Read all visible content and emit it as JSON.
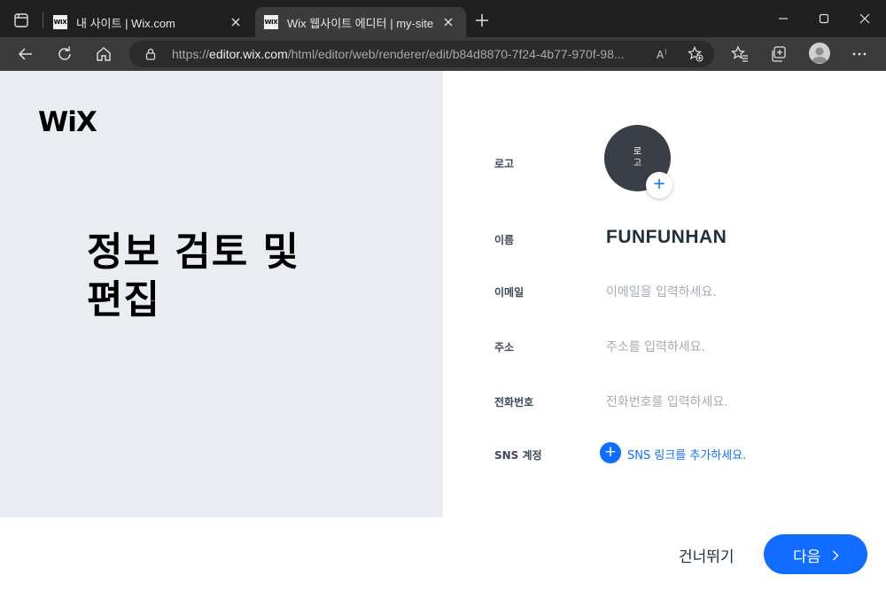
{
  "browser": {
    "tabs": [
      {
        "favicon": "WIX",
        "title": "내 사이트 | Wix.com",
        "active": false
      },
      {
        "favicon": "WIX",
        "title": "Wix 웹사이트 에디터 | my-site",
        "active": true
      }
    ],
    "url_scheme": "https://",
    "url_host": "editor.wix.com",
    "url_path": "/html/editor/web/renderer/edit/b84d8870-7f24-4b77-970f-98..."
  },
  "page": {
    "brand": "WiX",
    "title_line1": "정보 검토 및",
    "title_line2": "편집",
    "fields": {
      "logo": {
        "label": "로고",
        "placeholder_line1": "로",
        "placeholder_line2": "고",
        "add_icon": "+"
      },
      "name": {
        "label": "이름",
        "value": "FUNFUNHAN"
      },
      "email": {
        "label": "이메일",
        "placeholder": "이메일을 입력하세요."
      },
      "address": {
        "label": "주소",
        "placeholder": "주소를 입력하세요."
      },
      "phone": {
        "label": "전화번호",
        "placeholder": "전화번호를 입력하세요."
      },
      "sns": {
        "label": "SNS 계정",
        "link": "SNS 링크를 추가하세요.",
        "add_icon": "+"
      }
    },
    "footer": {
      "skip_label": "건너뛰기",
      "next_label": "다음"
    }
  },
  "colors": {
    "accent": "#116dff",
    "left_panel": "#e9ecf0",
    "logo_circle": "#3a3f47"
  }
}
